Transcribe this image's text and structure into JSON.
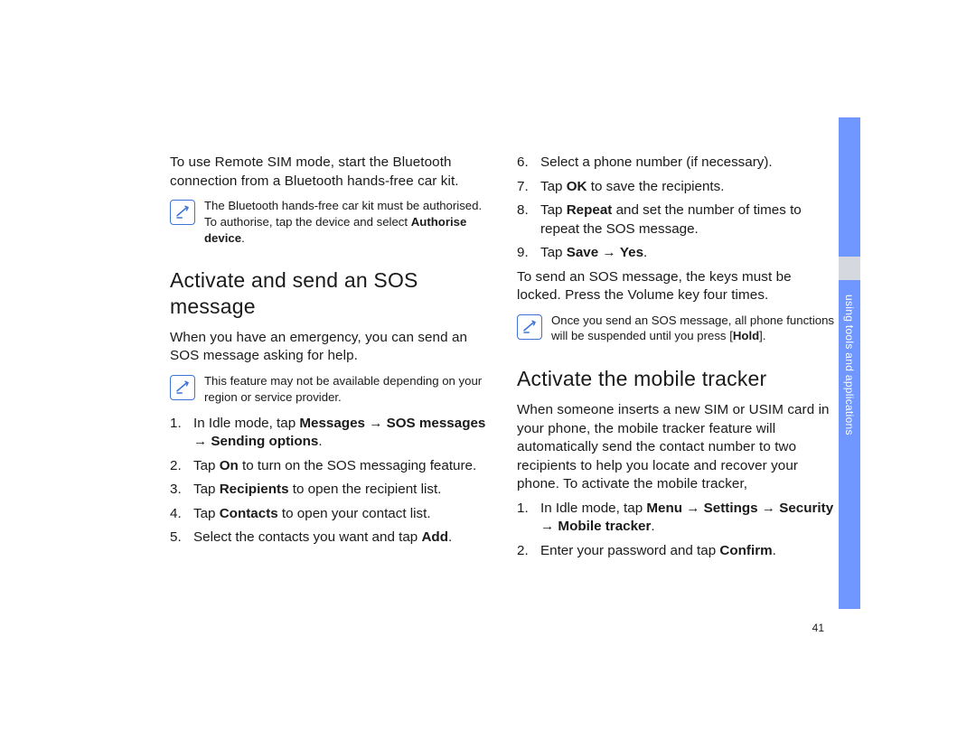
{
  "left": {
    "intro": "To use Remote SIM mode, start the Bluetooth connection from a Bluetooth hands-free car kit.",
    "note1_a": "The Bluetooth hands-free car kit must be authorised. To authorise, tap the device and select ",
    "note1_b": "Authorise device",
    "note1_c": ".",
    "h2": "Activate and send an SOS message",
    "intro2": "When you have an emergency, you can send an SOS message asking for help.",
    "note2": "This feature may not be available depending on your region or service provider.",
    "step1_a": "In Idle mode, tap ",
    "step1_b": "Messages",
    "step1_arr1": " → ",
    "step1_c": "SOS messages",
    "step1_arr2": " → ",
    "step1_d": "Sending options",
    "step1_e": ".",
    "step2_a": "Tap ",
    "step2_b": "On",
    "step2_c": " to turn on the SOS messaging feature.",
    "step3_a": "Tap ",
    "step3_b": "Recipients",
    "step3_c": " to open the recipient list.",
    "step4_a": "Tap ",
    "step4_b": "Contacts",
    "step4_c": " to open your contact list.",
    "step5_a": "Select the contacts you want and tap ",
    "step5_b": "Add",
    "step5_c": "."
  },
  "right": {
    "step6": "Select a phone number (if necessary).",
    "step7_a": "Tap ",
    "step7_b": "OK",
    "step7_c": " to save the recipients.",
    "step8_a": "Tap ",
    "step8_b": "Repeat",
    "step8_c": " and set the number of times to repeat the SOS message.",
    "step9_a": "Tap ",
    "step9_b": "Save",
    "step9_arr": " → ",
    "step9_c": "Yes",
    "step9_d": ".",
    "after": "To send an SOS message, the keys must be locked. Press the Volume key four times.",
    "note3_a": "Once you send an SOS message, all phone functions will be suspended until you press [",
    "note3_b": "Hold",
    "note3_c": "].",
    "h2": "Activate the mobile tracker",
    "intro": "When someone inserts a new SIM or USIM card in your phone, the mobile tracker feature will automatically send the contact number to two recipients to help you locate and recover your phone. To activate the mobile tracker,",
    "mstep1_a": "In Idle mode, tap ",
    "mstep1_b": "Menu",
    "mstep1_arr1": " → ",
    "mstep1_c": "Settings",
    "mstep1_arr2": " → ",
    "mstep1_d": "Security",
    "mstep1_arr3": " → ",
    "mstep1_e": "Mobile tracker",
    "mstep1_f": ".",
    "mstep2_a": "Enter your password and tap ",
    "mstep2_b": "Confirm",
    "mstep2_c": "."
  },
  "tab_label": "using tools and applications",
  "page_number": "41"
}
